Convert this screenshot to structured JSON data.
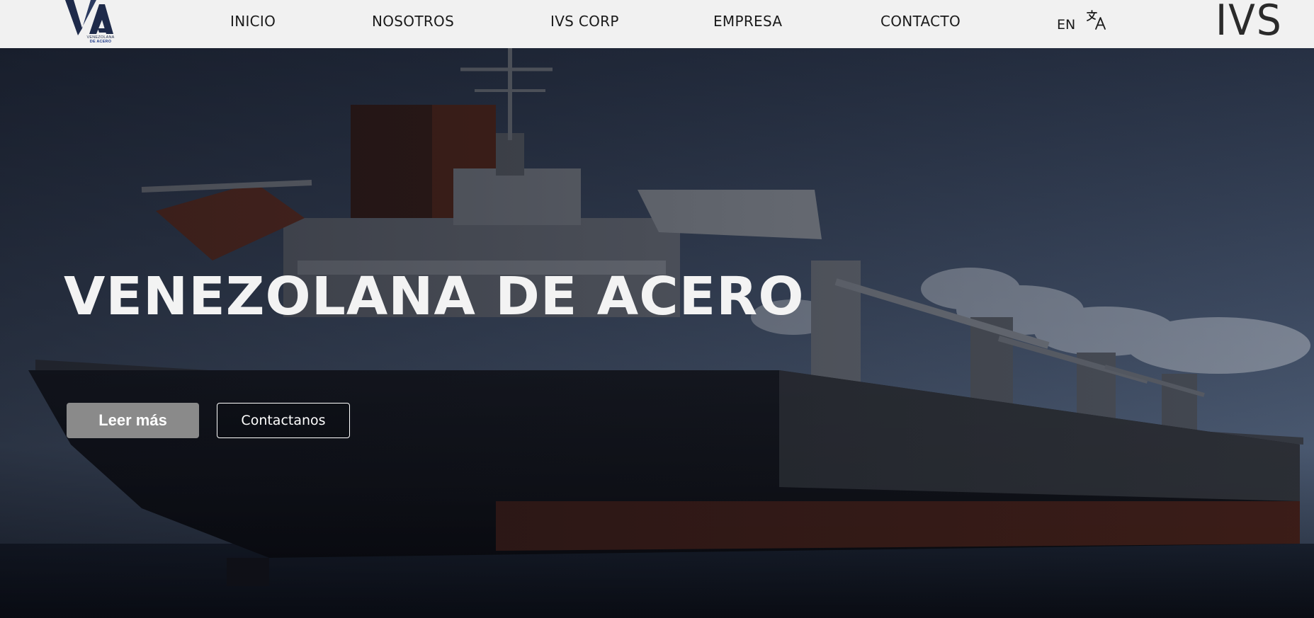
{
  "header": {
    "logo": {
      "initials": "VA",
      "subtitle_line1": "VENEZOLANA",
      "subtitle_line2": "DE ACERO"
    },
    "nav": [
      {
        "label": "INICIO"
      },
      {
        "label": "NOSOTROS"
      },
      {
        "label": "IVS CORP"
      },
      {
        "label": "EMPRESA"
      },
      {
        "label": "CONTACTO"
      }
    ],
    "language": "EN",
    "translate_icon": "translate-icon",
    "brand": "IVS"
  },
  "hero": {
    "title": "VENEZOLANA DE ACERO",
    "primary_button": "Leer más",
    "secondary_button": "Contactanos",
    "background": "ship-photo"
  },
  "colors": {
    "header_bg": "#f1f1f1",
    "logo_navy": "#1e2a4a",
    "primary_button": "#8a8a8a",
    "title_text": "#f3f3f3"
  }
}
